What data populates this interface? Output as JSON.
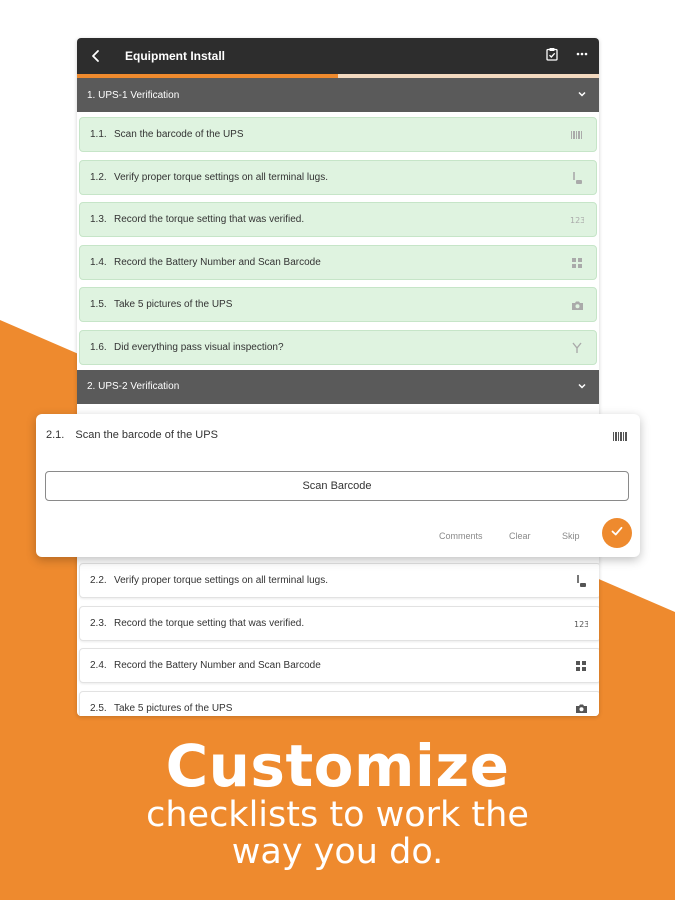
{
  "header": {
    "title": "Equipment Install",
    "back_icon": "arrow-left-icon",
    "action_icons": [
      "clipboard-check-icon",
      "more-dots-icon"
    ]
  },
  "progress": {
    "fraction": 0.5
  },
  "sections": [
    {
      "title": "1.  UPS-1 Verification",
      "items": [
        {
          "num": "1.1.",
          "label": "Scan the barcode of the UPS",
          "icon": "barcode-icon"
        },
        {
          "num": "1.2.",
          "label": "Verify proper torque settings on all terminal lugs.",
          "icon": "torque-wrench-icon"
        },
        {
          "num": "1.3.",
          "label": "Record the torque setting that was verified.",
          "icon": "number-123-icon"
        },
        {
          "num": "1.4.",
          "label": "Record the Battery Number and Scan Barcode",
          "icon": "grid-icon"
        },
        {
          "num": "1.5.",
          "label": "Take 5 pictures of the UPS",
          "icon": "camera-icon"
        },
        {
          "num": "1.6.",
          "label": "Did everything pass visual inspection?",
          "icon": "branch-icon"
        }
      ]
    },
    {
      "title": "2.  UPS-2 Verification",
      "items": [
        {
          "num": "2.2.",
          "label": "Verify proper torque settings on all terminal lugs.",
          "icon": "torque-wrench-icon"
        },
        {
          "num": "2.3.",
          "label": "Record the torque setting that was verified.",
          "icon": "number-123-icon"
        },
        {
          "num": "2.4.",
          "label": "Record the Battery Number and Scan Barcode",
          "icon": "grid-icon"
        },
        {
          "num": "2.5.",
          "label": "Take 5 pictures of the UPS",
          "icon": "camera-icon"
        }
      ]
    }
  ],
  "popup": {
    "num": "2.1.",
    "label": "Scan the barcode of the UPS",
    "icon": "barcode-icon",
    "scan_button": "Scan Barcode",
    "actions": {
      "comments": "Comments",
      "clear": "Clear",
      "skip": "Skip"
    },
    "confirm_icon": "checkmark-icon"
  },
  "promo": {
    "line1": "Customize",
    "line2": "checklists to work the",
    "line3": "way you do."
  },
  "colors": {
    "accent": "#ee8a2e",
    "done_bg": "#dff3e0",
    "topbar": "#2d2d2d",
    "section": "#5a5a5a"
  }
}
